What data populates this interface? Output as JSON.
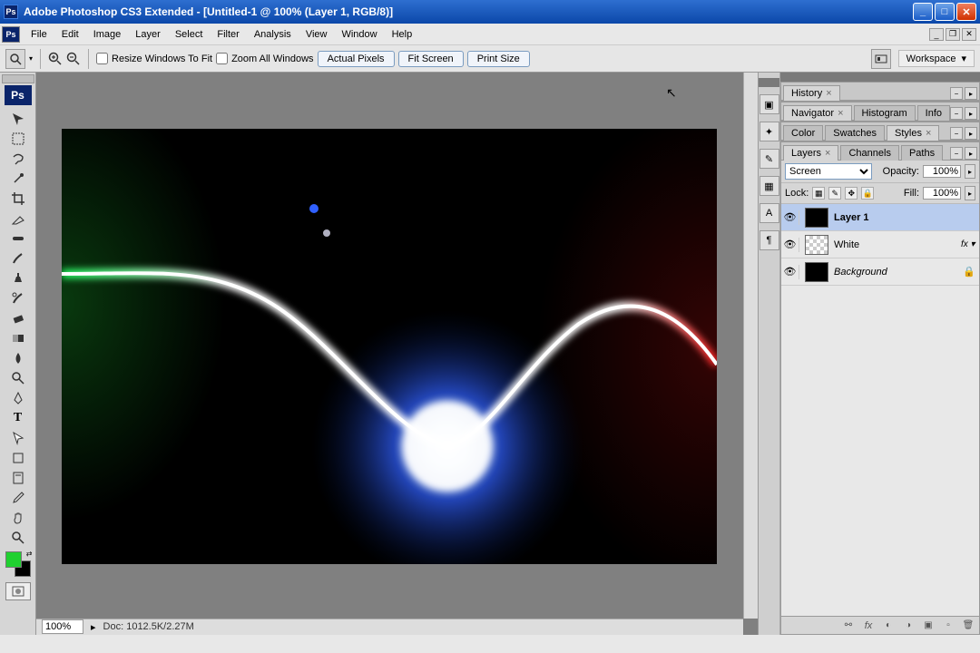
{
  "titlebar": {
    "app_icon_text": "Ps",
    "title": "Adobe Photoshop CS3 Extended - [Untitled-1 @ 100% (Layer 1, RGB/8)]"
  },
  "menubar": {
    "icon_text": "Ps",
    "items": [
      "File",
      "Edit",
      "Image",
      "Layer",
      "Select",
      "Filter",
      "Analysis",
      "View",
      "Window",
      "Help"
    ]
  },
  "optionsbar": {
    "resize_windows": "Resize Windows To Fit",
    "zoom_all": "Zoom All Windows",
    "actual_pixels": "Actual Pixels",
    "fit_screen": "Fit Screen",
    "print_size": "Print Size",
    "workspace": "Workspace"
  },
  "statusbar": {
    "zoom": "100%",
    "doc_info": "Doc: 1012.5K/2.27M"
  },
  "panels": {
    "history": "History",
    "navigator": "Navigator",
    "histogram": "Histogram",
    "info": "Info",
    "color": "Color",
    "swatches": "Swatches",
    "styles": "Styles",
    "layers": "Layers",
    "channels": "Channels",
    "paths": "Paths"
  },
  "layers_panel": {
    "blend_mode": "Screen",
    "opacity_label": "Opacity:",
    "opacity_value": "100%",
    "lock_label": "Lock:",
    "fill_label": "Fill:",
    "fill_value": "100%",
    "layers": [
      {
        "name": "Layer 1",
        "active": true,
        "bold": true,
        "thumb": "black"
      },
      {
        "name": "White",
        "active": false,
        "thumb": "checker",
        "fx": true
      },
      {
        "name": "Background",
        "active": false,
        "italic": true,
        "thumb": "black",
        "locked": true
      }
    ]
  },
  "colors": {
    "foreground": "#20d030",
    "background": "#000000"
  }
}
